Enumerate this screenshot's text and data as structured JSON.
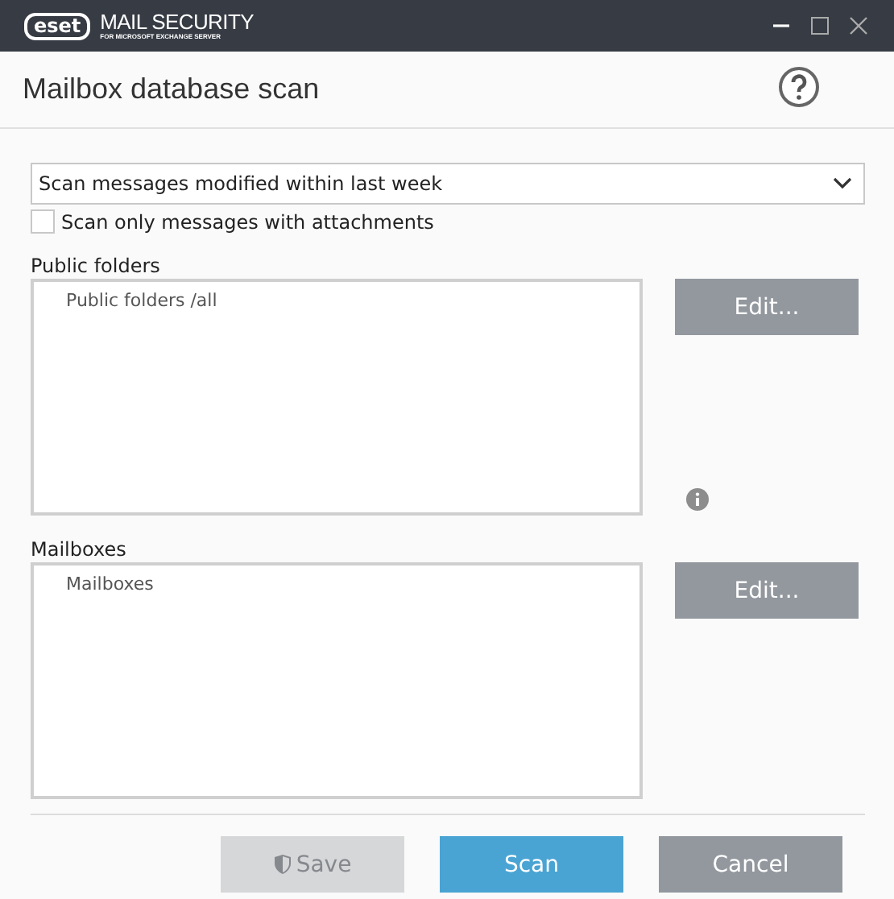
{
  "window": {
    "logo": "eset",
    "product": "MAIL SECURITY",
    "subtitle": "FOR MICROSOFT EXCHANGE SERVER"
  },
  "header": {
    "title": "Mailbox database scan"
  },
  "scan_filter": {
    "value": "Scan messages modified within last week"
  },
  "attachments_only": {
    "label": "Scan only messages with attachments",
    "checked": false
  },
  "sections": [
    {
      "label": "Public folders",
      "items": [
        "Public folders /all"
      ],
      "button": "Edit...",
      "info": true
    },
    {
      "label": "Mailboxes",
      "items": [
        "Mailboxes"
      ],
      "button": "Edit...",
      "info": false
    }
  ],
  "buttons": [
    {
      "kind": "save",
      "label": "Save",
      "disabled": true
    },
    {
      "kind": "primary",
      "label": "Scan",
      "disabled": false
    },
    {
      "kind": "secondary",
      "label": "Cancel",
      "disabled": false
    }
  ]
}
